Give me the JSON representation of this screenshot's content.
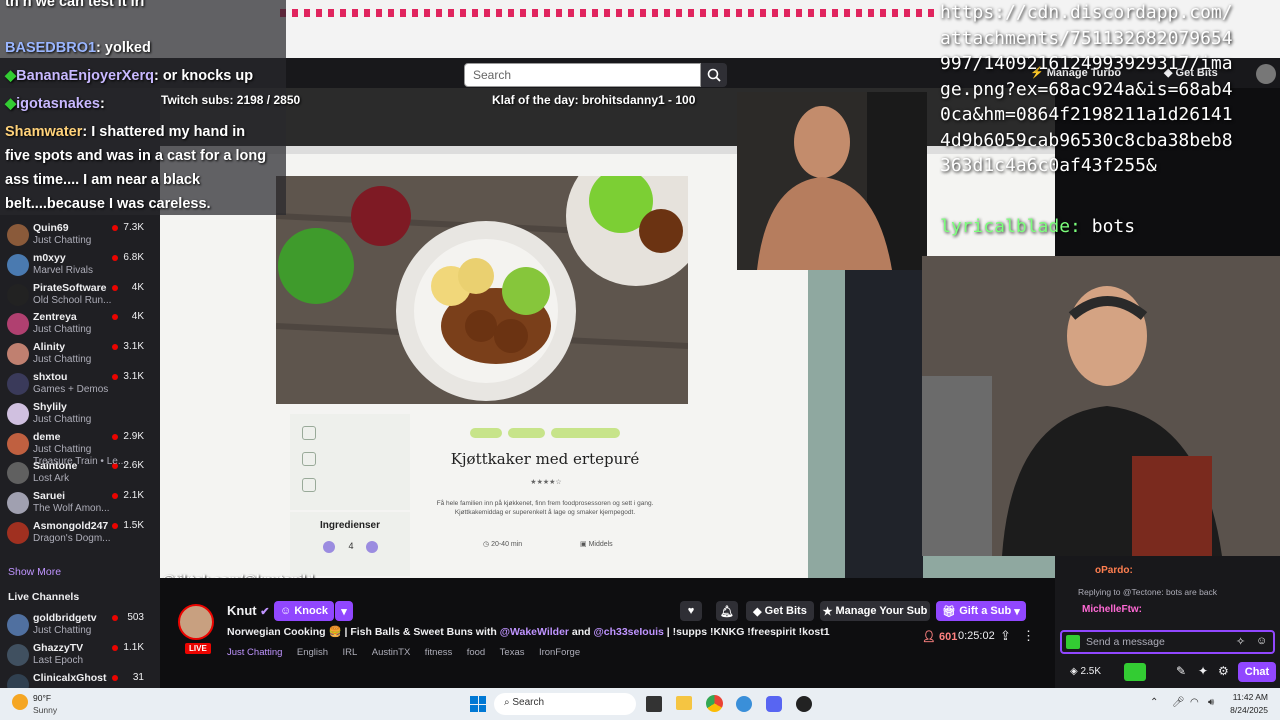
{
  "overlay_chat": {
    "lines": [
      {
        "user": "BASEDBRO1",
        "msg": ": yolked"
      },
      {
        "user": "BananaEnjoyerXerq",
        "msg": ": or knocks up"
      },
      {
        "user": "igotasnakes",
        "msg": ":"
      },
      {
        "user": "Shamwater",
        "msg": ": I shattered my hand in"
      }
    ],
    "top_line": "th n we can test it irl",
    "shamwater_cont": [
      "five spots and was in a cast for a long",
      "ass time.... I am near a black",
      "belt....because I was careless."
    ],
    "subs": "Twitch subs: 2198 / 2850",
    "klaf": "Klaf of the day: brohitsdanny1 - 100"
  },
  "url_overlay": "https://cdn.discordapp.com/attachments/751132682079654997/1409216124993929317/image.png?ex=68ac924a&is=68ab40ca&hm=0864f2198211a1d261414d9b6059cab96530c8cba38beb8363d1c4a6c0af43f255&",
  "lyrical": {
    "user": "lyricalblade:",
    "msg": "bots"
  },
  "search": {
    "placeholder": "Search"
  },
  "top_right": {
    "manage_turbo": "Manage Turbo",
    "get_bits": "Get Bits"
  },
  "sidebar": {
    "channels": [
      {
        "name": "Quin69",
        "cat": "Just Chatting",
        "viewers": "7.3K",
        "color": "#8a5a3a"
      },
      {
        "name": "m0xyy",
        "cat": "Marvel Rivals",
        "viewers": "6.8K",
        "color": "#4a7ab0"
      },
      {
        "name": "PirateSoftware",
        "cat": "Old School Run...",
        "viewers": "4K",
        "color": "#222"
      },
      {
        "name": "Zentreya",
        "cat": "Just Chatting",
        "viewers": "4K",
        "color": "#b04070"
      },
      {
        "name": "Alinity",
        "cat": "Just Chatting",
        "viewers": "3.1K",
        "color": "#c08070"
      },
      {
        "name": "shxtou",
        "cat": "Games + Demos",
        "viewers": "3.1K",
        "color": "#3a3a5a"
      },
      {
        "name": "Shylily",
        "cat": "Just Chatting",
        "viewers": "",
        "color": "#d0c0e0"
      },
      {
        "name": "deme",
        "cat": "Just Chatting",
        "viewers": "2.9K",
        "color": "#c06040"
      },
      {
        "name": "Saintone",
        "cat": "Lost Ark",
        "viewers": "2.6K",
        "color": "#606060"
      },
      {
        "name": "Saruei",
        "cat": "The Wolf Amon...",
        "viewers": "2.1K",
        "color": "#a0a0b0"
      },
      {
        "name": "Asmongold247",
        "cat": "Dragon's Dogm...",
        "viewers": "1.5K",
        "color": "#a03020"
      }
    ],
    "deme_sub": "Treasure Train • Le...",
    "show_more": "Show More",
    "live_channels_title": "Live Channels",
    "live": [
      {
        "name": "goldbridgetv",
        "cat": "Just Chatting",
        "viewers": "503",
        "color": "#5070a0"
      },
      {
        "name": "GhazzyTV",
        "cat": "Last Epoch",
        "viewers": "1.1K",
        "color": "#405060"
      },
      {
        "name": "ClinicalxGhost",
        "cat": "",
        "viewers": "31",
        "color": "#304050"
      }
    ]
  },
  "video": {
    "recipe_title": "Kjøttkaker med ertepuré",
    "recipe_desc": "Få hele familien inn på kjøkkenet, finn frem foodprosessoren og sett i gang. Kjøttkakemiddag er superenkelt å lage og smaker kjempegodt.",
    "ingredients": "Ingredienser",
    "portions": "4",
    "time": "20-40 min",
    "meal": "Middels",
    "tiktok": "@tiktok.com/@knutspild"
  },
  "stream": {
    "streamer": "Knut",
    "knock": "Knock",
    "title_pre": "Norwegian Cooking 🍔 | Fish Balls & Sweet Buns with ",
    "mention1": "@WakeWilder",
    "and": " and ",
    "mention2": "@ch33seIouis",
    "title_post": " | !supps !KNKG !freespirit !kost1",
    "category": "Just Chatting",
    "tags": [
      "English",
      "IRL",
      "AustinTX",
      "fitness",
      "food",
      "Texas",
      "IronForge"
    ],
    "viewers": "601",
    "uptime": "0:25:02",
    "live": "LIVE",
    "get_bits": "Get Bits",
    "manage_sub": "Manage Your Sub",
    "gift_sub": "Gift a Sub"
  },
  "chat": {
    "reply_to": "Replying to @Tectone: bots are back",
    "reply_user": "MichelleFtw:",
    "oPardo": "oPardo:",
    "placeholder": "Send a message",
    "points": "2.5K",
    "chat_btn": "Chat"
  },
  "taskbar": {
    "weather_temp": "90°F",
    "weather_desc": "Sunny",
    "search": "Search",
    "time": "11:42 AM",
    "date": "8/24/2025"
  },
  "colors": {
    "accent": "#9147ff",
    "live": "#eb0400",
    "sidebar": "#1f1f23"
  }
}
